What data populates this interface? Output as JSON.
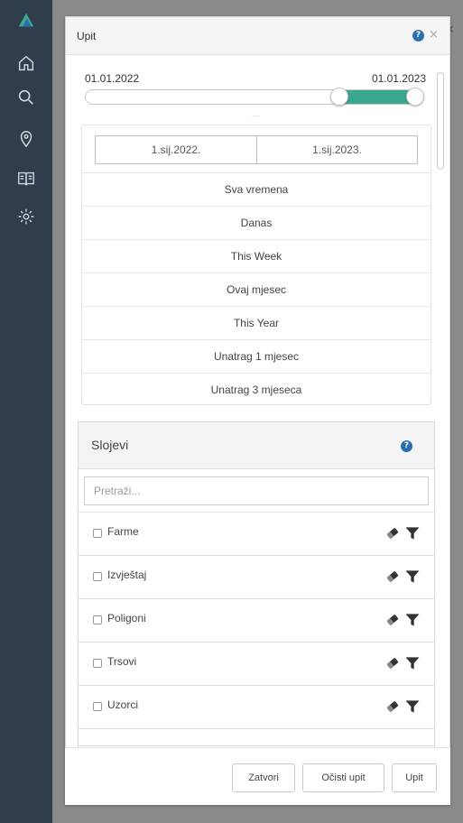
{
  "panel": {
    "title": "Upit",
    "help_glyph": "?",
    "close_glyph": "×",
    "collapse_glyph": "«"
  },
  "sidebar": {
    "items": [
      {
        "name": "logo",
        "icon": "logo-icon"
      },
      {
        "name": "home",
        "icon": "home-icon"
      },
      {
        "name": "search",
        "icon": "search-icon"
      },
      {
        "name": "location",
        "icon": "location-pin-icon"
      },
      {
        "name": "book",
        "icon": "book-icon"
      },
      {
        "name": "settings",
        "icon": "gear-icon"
      }
    ]
  },
  "time_range": {
    "start_label": "01.01.2022",
    "end_label": "01.01.2023",
    "range_fill_start_fraction": 0.75,
    "range_fill_end_fraction": 1.0,
    "grip": "...",
    "from_date": "1.sij.2022.",
    "to_date": "1.sij.2023.",
    "periods": [
      "Sva vremena",
      "Danas",
      "This Week",
      "Ovaj mjesec",
      "This Year",
      "Unatrag 1 mjesec",
      "Unatrag 3 mjeseca"
    ]
  },
  "layers": {
    "title": "Slojevi",
    "search_placeholder": "Pretraži...",
    "items": [
      {
        "label": "Farme"
      },
      {
        "label": "Izvještaj"
      },
      {
        "label": "Poligoni"
      },
      {
        "label": "Trsovi"
      },
      {
        "label": "Uzorci"
      }
    ]
  },
  "footer": {
    "close_label": "Zatvori",
    "clear_label": "Očisti upit",
    "query_label": "Upit"
  },
  "colors": {
    "sidebar": "#2f3d4c",
    "accent": "#3aa891",
    "help": "#2d6eae"
  }
}
